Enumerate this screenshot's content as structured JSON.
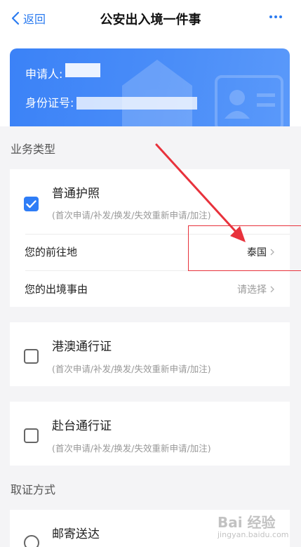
{
  "header": {
    "back_label": "返回",
    "title": "公安出入境一件事",
    "more_icon": "more-icon"
  },
  "applicant": {
    "name_label": "申请人:",
    "id_label": "身份证号:"
  },
  "business": {
    "section_label": "业务类型",
    "options": [
      {
        "title": "普通护照",
        "subtitle": "(首次申请/补发/换发/失效重新申请/加注)",
        "checked": true
      },
      {
        "title": "港澳通行证",
        "subtitle": "(首次申请/补发/换发/失效重新申请/加注)",
        "checked": false
      },
      {
        "title": "赴台通行证",
        "subtitle": "(首次申请/补发/换发/失效重新申请/加注)",
        "checked": false
      }
    ],
    "destination": {
      "label": "您的前往地",
      "value": "泰国"
    },
    "reason": {
      "label": "您的出境事由",
      "placeholder": "请选择"
    }
  },
  "pickup": {
    "section_label": "取证方式",
    "options": [
      {
        "title": "邮寄送达"
      }
    ]
  },
  "watermark": {
    "brand": "Bai 经验",
    "url": "jingyan.baidu.com"
  },
  "colors": {
    "accent": "#2f7df6",
    "annotation": "#e8323c"
  }
}
